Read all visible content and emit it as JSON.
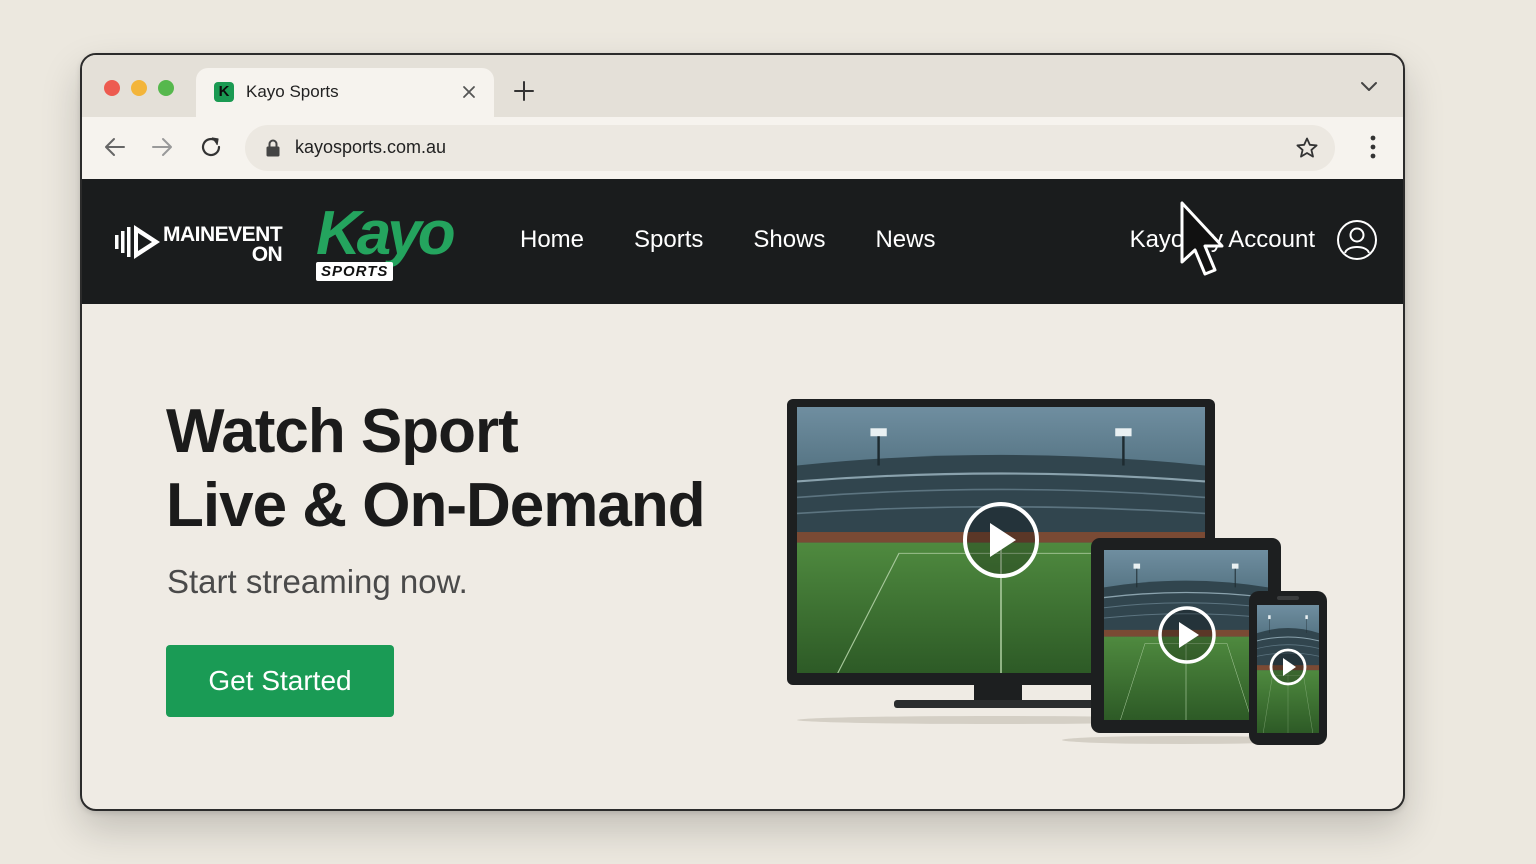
{
  "browser": {
    "tab_title": "Kayo Sports",
    "tab_favicon_letter": "K",
    "url": "kayosports.com.au",
    "traffic_lights": [
      "#ed5b50",
      "#f3b53a",
      "#56b84d"
    ]
  },
  "site": {
    "brand_partner": {
      "line1": "MAINEVENT",
      "line2": "ON"
    },
    "logo": {
      "word": "Kayo",
      "tag": "SPORTS",
      "color": "#24a45e"
    },
    "nav": [
      "Home",
      "Sports",
      "Shows",
      "News"
    ],
    "account_label": "Kayo My Account"
  },
  "hero": {
    "title_line1": "Watch Sport",
    "title_line2": "Live & On-Demand",
    "subtitle": "Start streaming now.",
    "cta_label": "Get Started",
    "cta_color": "#1a9b55"
  },
  "icons": [
    "close-icon",
    "plus-icon",
    "chevron-down-icon",
    "back-arrow-icon",
    "forward-arrow-icon",
    "reload-icon",
    "lock-icon",
    "star-icon",
    "more-vert-icon",
    "user-account-icon",
    "play-icon",
    "mouse-pointer-icon"
  ]
}
